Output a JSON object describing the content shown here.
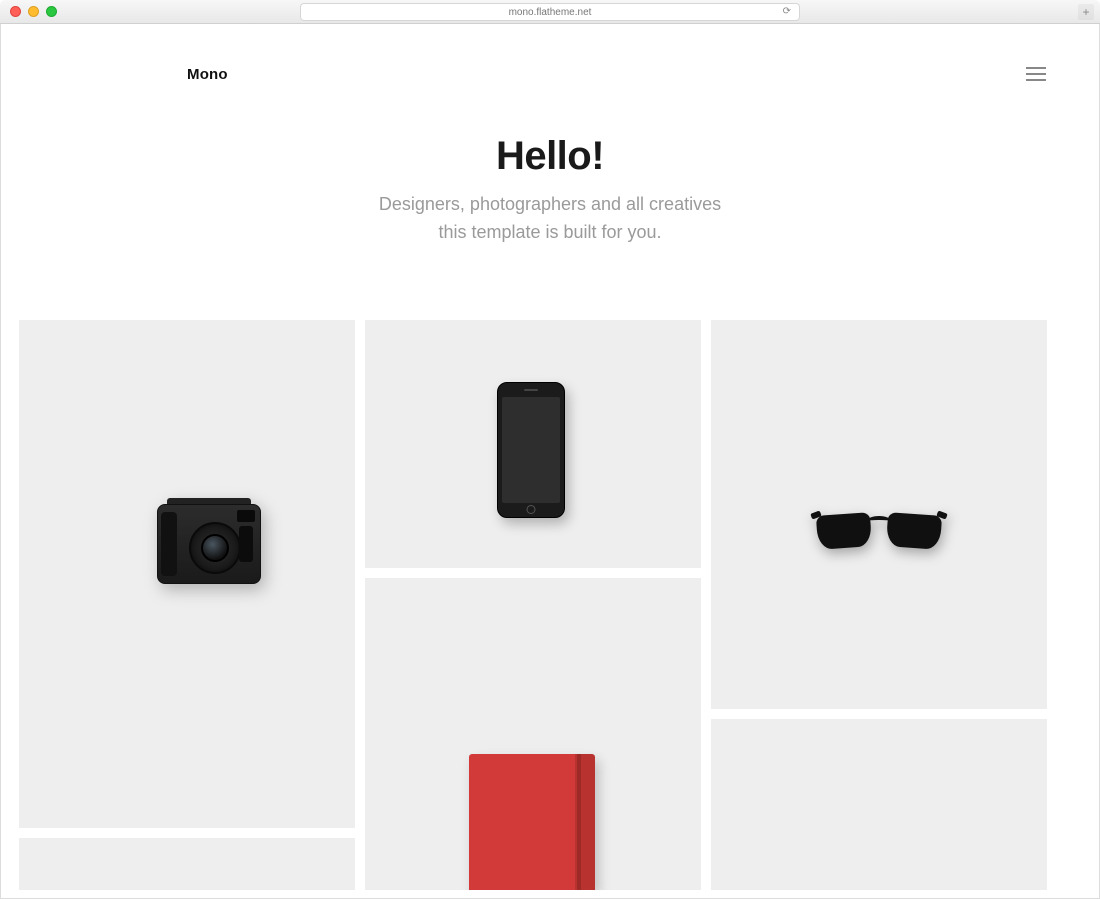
{
  "browser": {
    "address": "mono.flatheme.net"
  },
  "nav": {
    "brand": "Mono"
  },
  "hero": {
    "title": "Hello!",
    "subtitle_line1": "Designers, photographers and all creatives",
    "subtitle_line2": "this template is built for you."
  },
  "tiles": [
    {
      "id": "camera",
      "label": "Camera"
    },
    {
      "id": "phone",
      "label": "Smartphone"
    },
    {
      "id": "sunglasses",
      "label": "Sunglasses"
    },
    {
      "id": "notebook",
      "label": "Red Notebook"
    }
  ]
}
